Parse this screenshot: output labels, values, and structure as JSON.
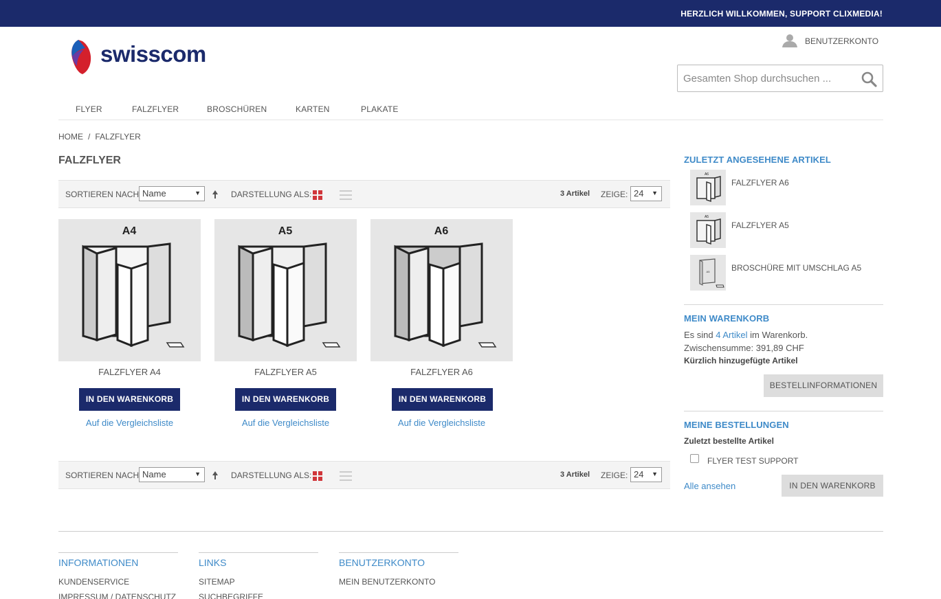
{
  "colors": {
    "brand": "#1b2a6b",
    "link": "#3e8ac8",
    "grid_active": "#d0363a"
  },
  "topbar": {
    "welcome": "HERZLICH WILLKOMMEN, SUPPORT CLIXMEDIA!"
  },
  "header": {
    "logo_text": "swisscom",
    "account_label": "BENUTZERKONTO",
    "search_placeholder": "Gesamten Shop durchsuchen ..."
  },
  "nav": {
    "items": [
      "FLYER",
      "FALZFLYER",
      "BROSCHÜREN",
      "KARTEN",
      "PLAKATE"
    ]
  },
  "breadcrumb": {
    "home": "HOME",
    "separator": "/",
    "current": "FALZFLYER"
  },
  "page": {
    "title": "FALZFLYER"
  },
  "toolbar": {
    "sort_label": "SORTIEREN NACH:",
    "sort_value": "Name",
    "view_label": "DARSTELLUNG ALS:",
    "count": "3 Artikel",
    "show_label": "ZEIGE:",
    "show_value": "24"
  },
  "products": [
    {
      "format": "A4",
      "name": "FALZFLYER A4",
      "cart_label": "IN DEN WARENKORB",
      "compare_label": "Auf die Vergleichsliste"
    },
    {
      "format": "A5",
      "name": "FALZFLYER A5",
      "cart_label": "IN DEN WARENKORB",
      "compare_label": "Auf die Vergleichsliste"
    },
    {
      "format": "A6",
      "name": "FALZFLYER A6",
      "cart_label": "IN DEN WARENKORB",
      "compare_label": "Auf die Vergleichsliste"
    }
  ],
  "sidebar": {
    "recent_title": "ZULETZT ANGESEHENE ARTIKEL",
    "recent_items": [
      {
        "label": "FALZFLYER A6",
        "thumb": "A6"
      },
      {
        "label": "FALZFLYER A5",
        "thumb": "A5"
      },
      {
        "label": "BROSCHÜRE MIT UMSCHLAG A5",
        "thumb": "A5"
      }
    ],
    "cart_title": "MEIN WARENKORB",
    "cart_text_pre": "Es sind",
    "cart_link": "4 Artikel",
    "cart_text_post": "im Warenkorb.",
    "subtotal": "Zwischensumme: 391,89 CHF",
    "recently_added": "Kürzlich hinzugefügte Artikel",
    "checkout_label": "BESTELLINFORMATIONEN",
    "orders_title": "MEINE BESTELLUNGEN",
    "orders_subtitle": "Zuletzt bestellte Artikel",
    "order_item": "FLYER TEST SUPPORT",
    "view_all": "Alle ansehen",
    "add_to_cart": "IN DEN WARENKORB"
  },
  "footer": {
    "columns": [
      {
        "title": "INFORMATIONEN",
        "links": [
          "KUNDENSERVICE",
          "IMPRESSUM / DATENSCHUTZ"
        ]
      },
      {
        "title": "LINKS",
        "links": [
          "SITEMAP",
          "SUCHBEGRIFFE"
        ]
      },
      {
        "title": "BENUTZERKONTO",
        "links": [
          "MEIN BENUTZERKONTO"
        ]
      }
    ]
  }
}
